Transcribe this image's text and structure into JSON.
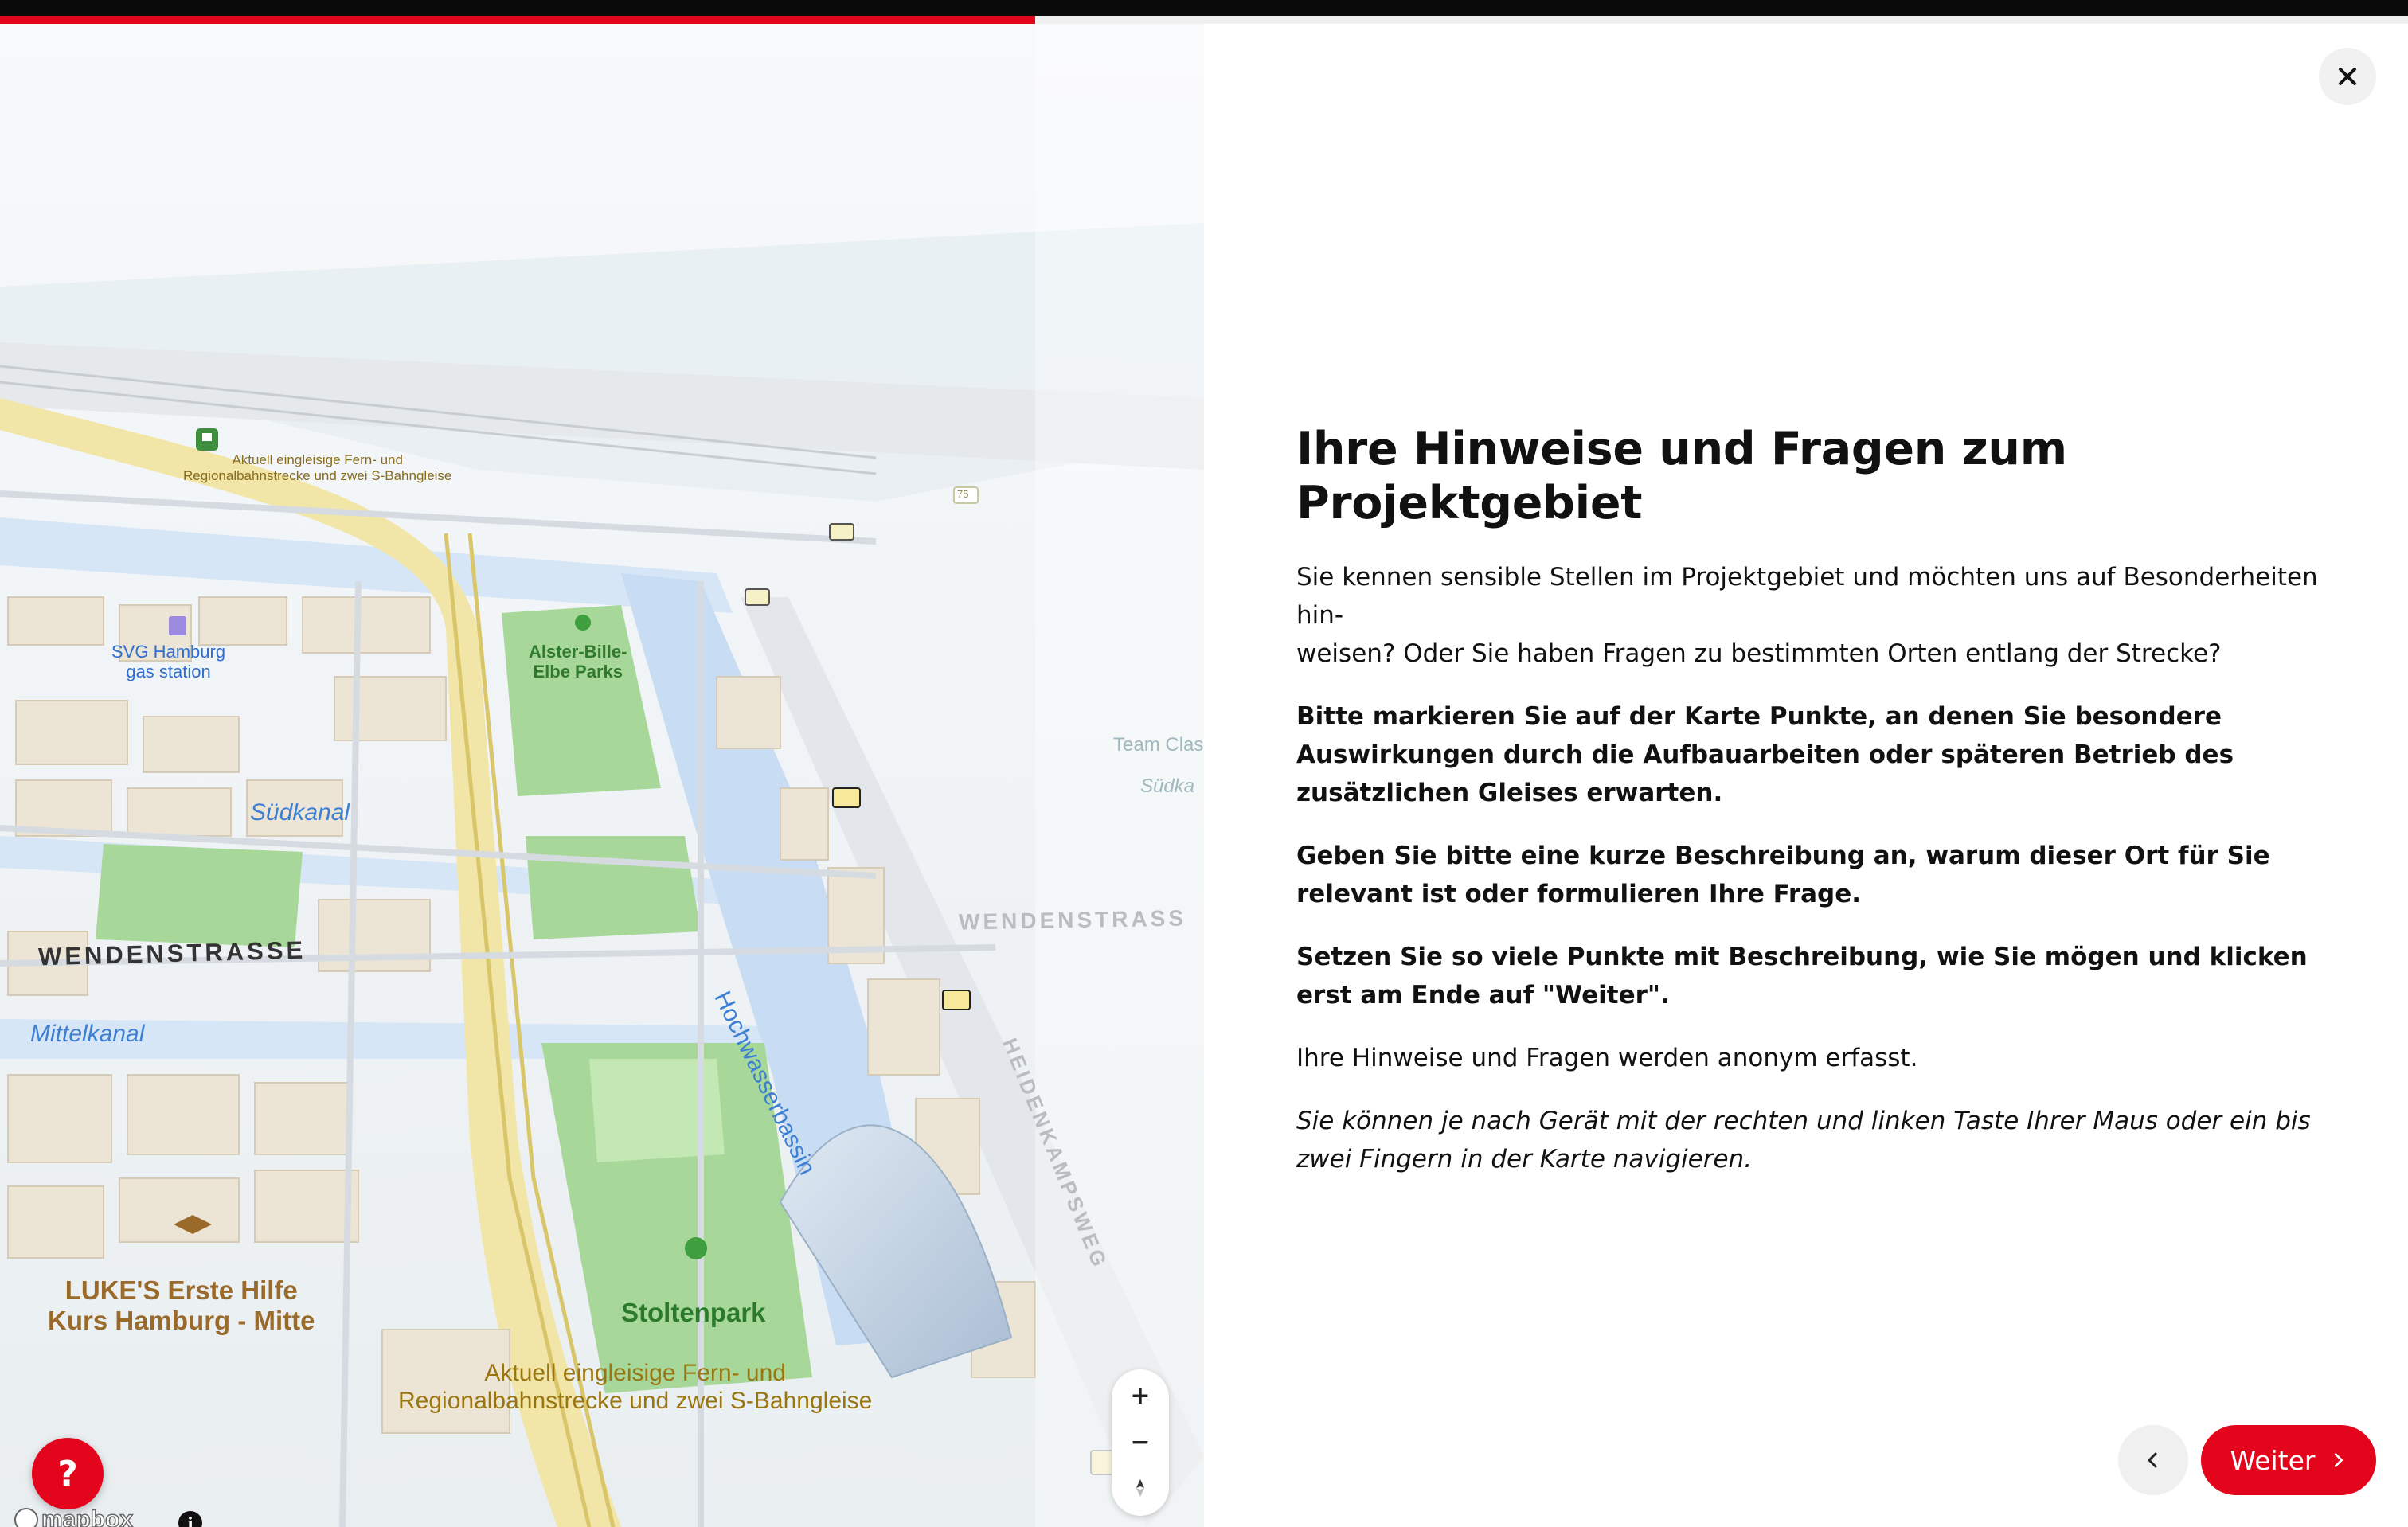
{
  "progress": {
    "fraction": 0.43
  },
  "colors": {
    "accent": "#e3051b"
  },
  "map": {
    "labels": {
      "rail_top": "Aktuell eingleisige Fern- und\nRegionalbahnstrecke und zwei S-Bahngleise",
      "gas_station": "SVG Hamburg\ngas station",
      "park_alster": "Alster-Bille-\nElbe Parks",
      "team": "Team Clas",
      "suedkanal": "Südkanal",
      "suedka_faint": "Südka",
      "wendenstrasse": "WENDENSTRASSE",
      "wendenstrass_faint": "WENDENSTRASS",
      "mittelkanal": "Mittelkanal",
      "hochwasserbassin": "Hochwasserbassin",
      "heidenkampsweg": "HEIDENKAMPSWEG",
      "lukes": "LUKE'S Erste Hilfe\nKurs Hamburg - Mitte",
      "stoltenpark": "Stoltenpark",
      "rail_bottom": "Aktuell eingleisige Fern- und\nRegionalbahnstrecke und zwei S-Bahngleise",
      "route_75": "75"
    },
    "controls": {
      "zoom_in": "+",
      "zoom_out": "−",
      "compass_icon": "compass-icon"
    },
    "help_label": "?",
    "attribution": "mapbox",
    "info_label": "i"
  },
  "panel": {
    "close_icon": "close-icon",
    "title": "Ihre Hinweise und Fragen zum Projektgebiet",
    "paragraphs": [
      "Sie kennen sensible Stellen im Projektgebiet und möchten uns auf Besonderheiten hin-\nweisen? Oder Sie haben Fragen zu bestimmten Orten entlang der Strecke?",
      "Bitte markieren Sie auf der Karte Punkte, an denen Sie besondere Auswirkungen durch die Aufbauarbeiten oder späteren Betrieb des zusätzlichen Gleises erwarten.",
      "Geben Sie bitte eine kurze Beschreibung an, warum dieser Ort für Sie relevant ist oder formulieren Ihre Frage.",
      "Setzen Sie so viele Punkte mit Beschreibung, wie Sie mögen und klicken erst am Ende auf \"Weiter\".",
      "Ihre Hinweise und Fragen werden anonym erfasst.",
      "Sie können je nach Gerät mit der rechten und linken Taste Ihrer Maus oder ein bis zwei Fingern in der Karte navigieren."
    ],
    "back_icon": "chevron-left-icon",
    "next_label": "Weiter",
    "next_icon": "chevron-right-icon"
  }
}
